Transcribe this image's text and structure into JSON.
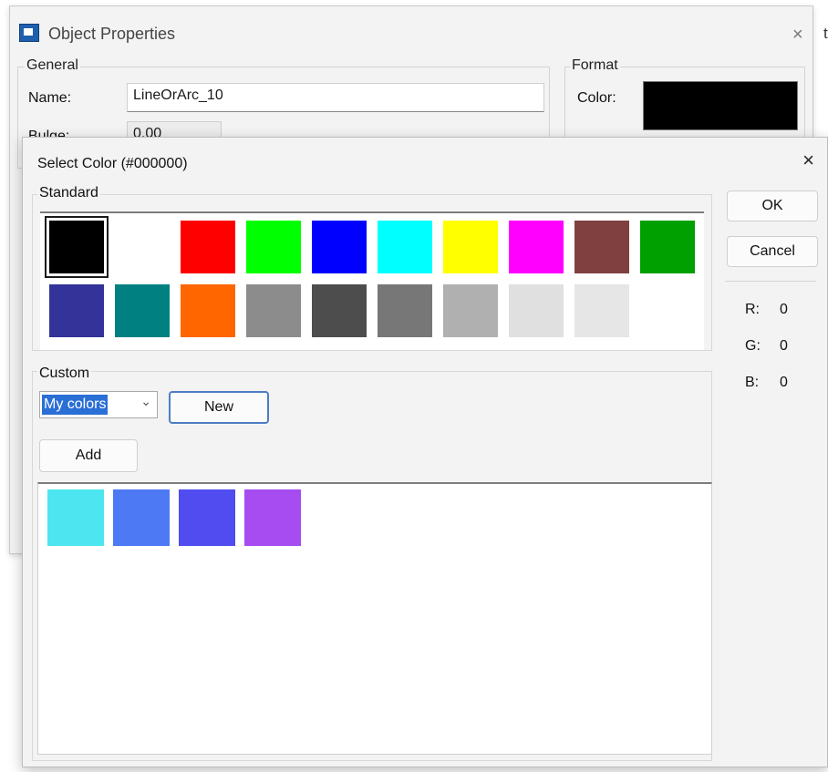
{
  "bg_window": {
    "title": "Object Properties",
    "close_glyph": "×",
    "truncated_text": "ti",
    "general_label": "General",
    "name_label": "Name:",
    "name_value": "LineOrArc_10",
    "bulge_label": "Bulge:",
    "bulge_value": "0.00",
    "format_label": "Format",
    "color_label": "Color:",
    "color_value": "#000000"
  },
  "dialog": {
    "title": "Select Color (#000000)",
    "close_glyph": "×",
    "standard_label": "Standard",
    "standard_colors": [
      "#000000",
      "#ffffff",
      "#ff0000",
      "#00ff00",
      "#0000ff",
      "#00ffff",
      "#ffff00",
      "#ff00ff",
      "#804040",
      "#00a000",
      "#333399",
      "#008080",
      "#ff6600",
      "#8c8c8c",
      "#4d4d4d",
      "#777777",
      "#b0b0b0",
      "#e0e0e0",
      "#e6e6e6",
      "#ffffff"
    ],
    "selected_index": 0,
    "custom_label": "Custom",
    "palette_select_value": "My colors",
    "new_button": "New",
    "add_button": "Add",
    "custom_colors": [
      "#4de6f0",
      "#4d79f5",
      "#504cf0",
      "#a64cf0"
    ],
    "ok_button": "OK",
    "cancel_button": "Cancel",
    "r_label": "R:",
    "r_value": "0",
    "g_label": "G:",
    "g_value": "0",
    "b_label": "B:",
    "b_value": "0"
  }
}
